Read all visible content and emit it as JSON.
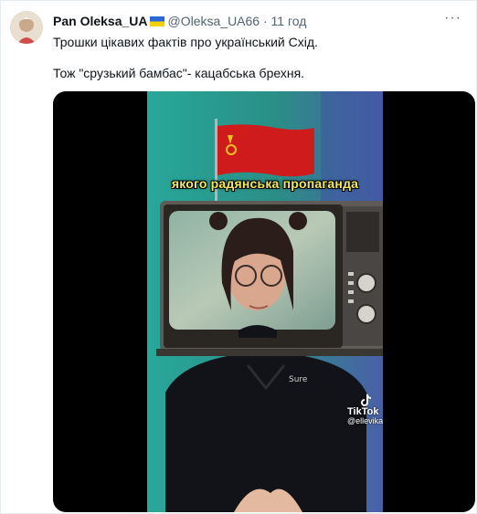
{
  "tweet": {
    "display_name": "Pan Oleksa_UA",
    "handle": "@Oleksa_UA66",
    "separator": "·",
    "timestamp": "11 год",
    "more_label": "···",
    "text_line_1": "Трошки цікавих фактів про український Схід.",
    "text_line_2": "Тож \"срузький бамбас\"- кацабська брехня."
  },
  "media": {
    "caption": "якого радянська пропаганда",
    "watermark_brand": "TikTok",
    "watermark_handle": "@ellevika",
    "icon": "tiktok-icon"
  },
  "colors": {
    "caption_yellow": "#f4ec4a",
    "wall_teal": "#2b8e86",
    "flag_red": "#cf1b1b",
    "handle_gray": "#536471"
  }
}
